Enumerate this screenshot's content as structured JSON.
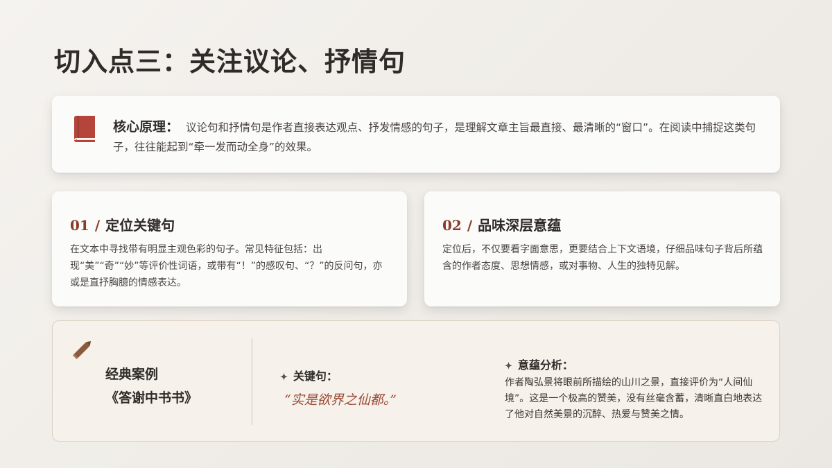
{
  "title": "切入点三：关注议论、抒情句",
  "principle": {
    "label": "核心原理：",
    "text": "议论句和抒情句是作者直接表达观点、抒发情感的句子，是理解文章主旨最直接、最清晰的“窗口”。在阅读中捕捉这类句子，往往能起到“牵一发而动全身”的效果。",
    "icon": "book-icon",
    "icon_color": "#b5443a"
  },
  "points": [
    {
      "num": "01",
      "sep": "/",
      "title": "定位关键句",
      "body": "在文本中寻找带有明显主观色彩的句子。常见特征包括：出现“美”“奇”“妙”等评价性词语，或带有“！”的感叹句、“？”的反问句，亦或是直抒胸臆的情感表达。"
    },
    {
      "num": "02",
      "sep": "/",
      "title": "品味深层意蕴",
      "body": "定位后，不仅要看字面意思，更要结合上下文语境，仔细品味句子背后所蕴含的作者态度、思想情感，或对事物、人生的独特见解。"
    }
  ],
  "case": {
    "icon": "pencil-icon",
    "icon_color": "#8a5a3c",
    "label_line1": "经典案例",
    "label_line2": "《答谢中书书》",
    "key_sentence_label": "关键句：",
    "key_sentence": "“实是欲界之仙都。”",
    "analysis_label": "意蕴分析：",
    "analysis_text": "作者陶弘景将眼前所描绘的山川之景，直接评价为“人间仙境”。这是一个极高的赞美，没有丝毫含蓄，清晰直白地表达了他对自然美景的沉醉、热爱与赞美之情。",
    "diamond": "✦"
  },
  "colors": {
    "accent": "#8a3a28",
    "quote": "#9a4a35",
    "case_bg": "#f6f1ea"
  }
}
